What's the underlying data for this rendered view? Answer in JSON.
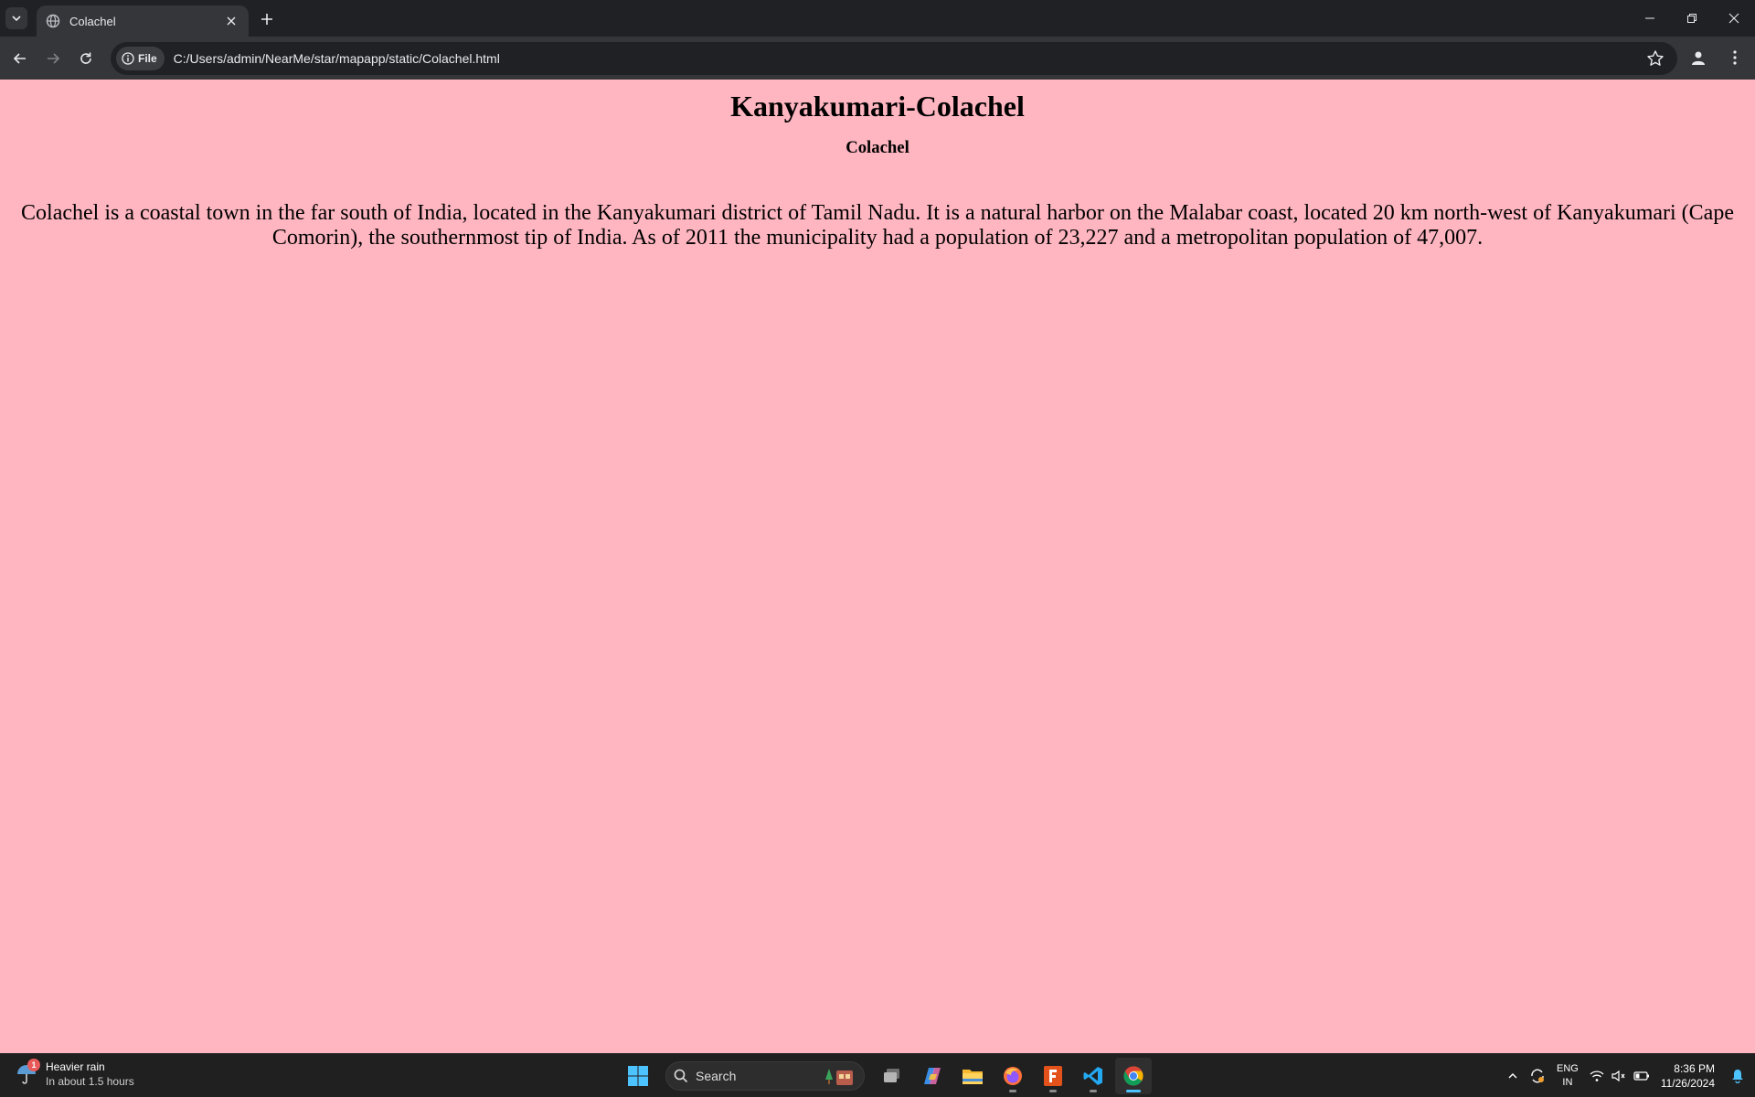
{
  "browser": {
    "tab": {
      "title": "Colachel"
    },
    "address_bar": {
      "chip_label": "File",
      "url": "C:/Users/admin/NearMe/star/mapapp/static/Colachel.html"
    }
  },
  "page": {
    "heading": "Kanyakumari-Colachel",
    "subheading": "Colachel",
    "paragraph": "Colachel is a coastal town in the far south of India, located in the Kanyakumari district of Tamil Nadu. It is a natural harbor on the Malabar coast, located 20 km north-west of Kanyakumari (Cape Comorin), the southernmost tip of India. As of 2011 the municipality had a population of 23,227 and a metropolitan population of 47,007.",
    "background_color": "#ffb6c1"
  },
  "taskbar": {
    "weather": {
      "badge": "1",
      "title": "Heavier rain",
      "subtitle": "In about 1.5 hours"
    },
    "search_label": "Search",
    "tray": {
      "lang_top": "ENG",
      "lang_bottom": "IN",
      "time": "8:36 PM",
      "date": "11/26/2024"
    }
  }
}
